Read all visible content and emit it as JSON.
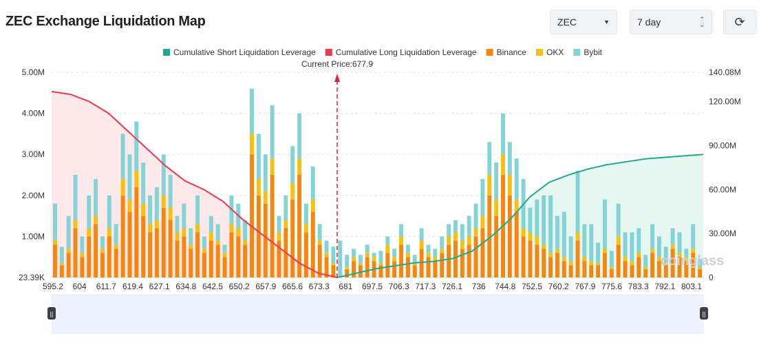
{
  "header": {
    "title": "ZEC Exchange Liquidation Map",
    "symbol_select": "ZEC",
    "period_select": "7 day",
    "refresh_icon": "refresh-icon"
  },
  "chart_data": {
    "type": "bar",
    "title": "",
    "current_price_label": "Current Price:677.9",
    "current_price": 677.9,
    "legend": [
      "Cumulative Short Liquidation Leverage",
      "Cumulative Long Liquidation Leverage",
      "Binance",
      "OKX",
      "Bybit"
    ],
    "legend_placement": "top",
    "colors": {
      "short": "#1fa98c",
      "long": "#f0394b",
      "binance": "#f7860f",
      "okx": "#f7c10f",
      "bybit": "#84d3d6"
    },
    "x_tick_labels": [
      "595.2",
      "604",
      "611.7",
      "619.4",
      "627.1",
      "634.8",
      "642.5",
      "650.2",
      "657.9",
      "665.6",
      "673.3",
      "681",
      "697.5",
      "706.3",
      "717.3",
      "726.1",
      "736",
      "744.8",
      "752.5",
      "760.2",
      "767.9",
      "775.6",
      "783.3",
      "792.1",
      "803.1"
    ],
    "y_left_ticks": [
      "23.39K",
      "1.00M",
      "2.00M",
      "3.00M",
      "4.00M",
      "5.00M"
    ],
    "y_left_range_M": [
      0,
      5
    ],
    "y_right_ticks": [
      "0",
      "30.00M",
      "60.00M",
      "90.00M",
      "120.00M",
      "140.08M"
    ],
    "y_right_range_M": [
      0,
      140.08
    ],
    "grid": true,
    "series": [
      {
        "name": "Binance",
        "values": [
          0.8,
          0.3,
          0.6,
          1.2,
          0.5,
          1.0,
          1.3,
          0.6,
          1.0,
          0.7,
          2.0,
          1.6,
          2.2,
          1.5,
          1.1,
          1.2,
          1.7,
          1.4,
          0.9,
          1.0,
          0.7,
          1.1,
          0.6,
          0.9,
          0.8,
          0.5,
          1.1,
          1.0,
          0.8,
          3.0,
          2.0,
          1.8,
          2.5,
          0.9,
          1.2,
          1.9,
          2.5,
          1.1,
          1.6,
          0.8,
          0.5,
          0.3,
          0.0,
          0.2,
          0.4,
          0.3,
          0.5,
          0.4,
          0.3,
          0.6,
          0.4,
          0.8,
          0.5,
          0.3,
          0.7,
          0.5,
          0.4,
          0.6,
          0.8,
          0.9,
          0.7,
          0.8,
          1.0,
          1.2,
          2.0,
          1.5,
          2.5,
          2.0,
          1.6,
          1.0,
          0.9,
          0.8,
          0.7,
          0.5,
          0.6,
          0.4,
          0.3,
          0.9,
          0.4,
          0.3,
          0.3,
          0.6,
          0.2,
          0.8,
          0.4,
          0.3,
          0.5,
          0.2,
          0.6,
          0.4,
          0.3,
          0.7,
          0.5,
          0.4,
          0.6,
          0.2
        ]
      },
      {
        "name": "OKX",
        "values": [
          0.1,
          0.05,
          0.1,
          0.2,
          0.1,
          0.2,
          0.2,
          0.1,
          0.2,
          0.1,
          0.4,
          0.3,
          0.4,
          0.3,
          0.2,
          0.2,
          0.3,
          0.3,
          0.2,
          0.2,
          0.1,
          0.2,
          0.1,
          0.2,
          0.1,
          0.1,
          0.2,
          0.2,
          0.1,
          0.5,
          0.4,
          0.3,
          0.4,
          0.2,
          0.2,
          0.4,
          0.4,
          0.2,
          0.3,
          0.1,
          0.1,
          0.05,
          0.0,
          0.05,
          0.1,
          0.05,
          0.1,
          0.1,
          0.05,
          0.2,
          0.1,
          0.2,
          0.1,
          0.05,
          0.2,
          0.1,
          0.1,
          0.1,
          0.2,
          0.2,
          0.2,
          0.2,
          0.2,
          0.3,
          0.5,
          0.4,
          0.5,
          0.5,
          0.3,
          0.2,
          0.2,
          0.2,
          0.1,
          0.1,
          0.1,
          0.1,
          0.1,
          0.2,
          0.1,
          0.1,
          0.05,
          0.1,
          0.05,
          0.2,
          0.1,
          0.1,
          0.1,
          0.05,
          0.1,
          0.1,
          0.05,
          0.1,
          0.1,
          0.1,
          0.1,
          0.05
        ]
      },
      {
        "name": "Bybit",
        "values": [
          0.9,
          0.4,
          0.8,
          1.1,
          0.4,
          0.8,
          0.9,
          0.3,
          0.8,
          0.5,
          1.1,
          1.1,
          1.2,
          1.0,
          0.7,
          0.8,
          1.0,
          0.8,
          0.4,
          0.6,
          0.4,
          0.7,
          0.3,
          0.4,
          0.4,
          0.2,
          0.7,
          0.6,
          0.5,
          1.1,
          1.1,
          0.9,
          1.3,
          0.4,
          0.6,
          0.9,
          1.1,
          0.5,
          0.8,
          0.4,
          0.3,
          0.4,
          0.9,
          0.3,
          0.2,
          0.2,
          0.2,
          0.1,
          0.3,
          0.2,
          0.2,
          0.3,
          0.2,
          0.2,
          0.3,
          0.2,
          0.2,
          0.3,
          0.3,
          0.3,
          0.4,
          0.5,
          0.6,
          0.9,
          0.8,
          0.9,
          1.0,
          0.8,
          1.0,
          1.2,
          0.6,
          0.9,
          1.2,
          1.4,
          0.8,
          1.1,
          0.6,
          1.5,
          0.8,
          0.9,
          0.5,
          1.2,
          0.4,
          0.8,
          0.6,
          0.7,
          0.6,
          0.3,
          0.6,
          0.5,
          0.4,
          0.4,
          0.5,
          0.2,
          0.6,
          0.2
        ]
      },
      {
        "name": "Cumulative Long Liquidation Leverage",
        "values": [
          127,
          125,
          120,
          112,
          100,
          88,
          76,
          66,
          60,
          52,
          40,
          30,
          20,
          10,
          3,
          0
        ]
      },
      {
        "name": "Cumulative Short Liquidation Leverage",
        "values": [
          0,
          3,
          6,
          8,
          10,
          11,
          13,
          18,
          28,
          40,
          55,
          65,
          70,
          74,
          77,
          79,
          81,
          82,
          83,
          84
        ]
      }
    ]
  }
}
